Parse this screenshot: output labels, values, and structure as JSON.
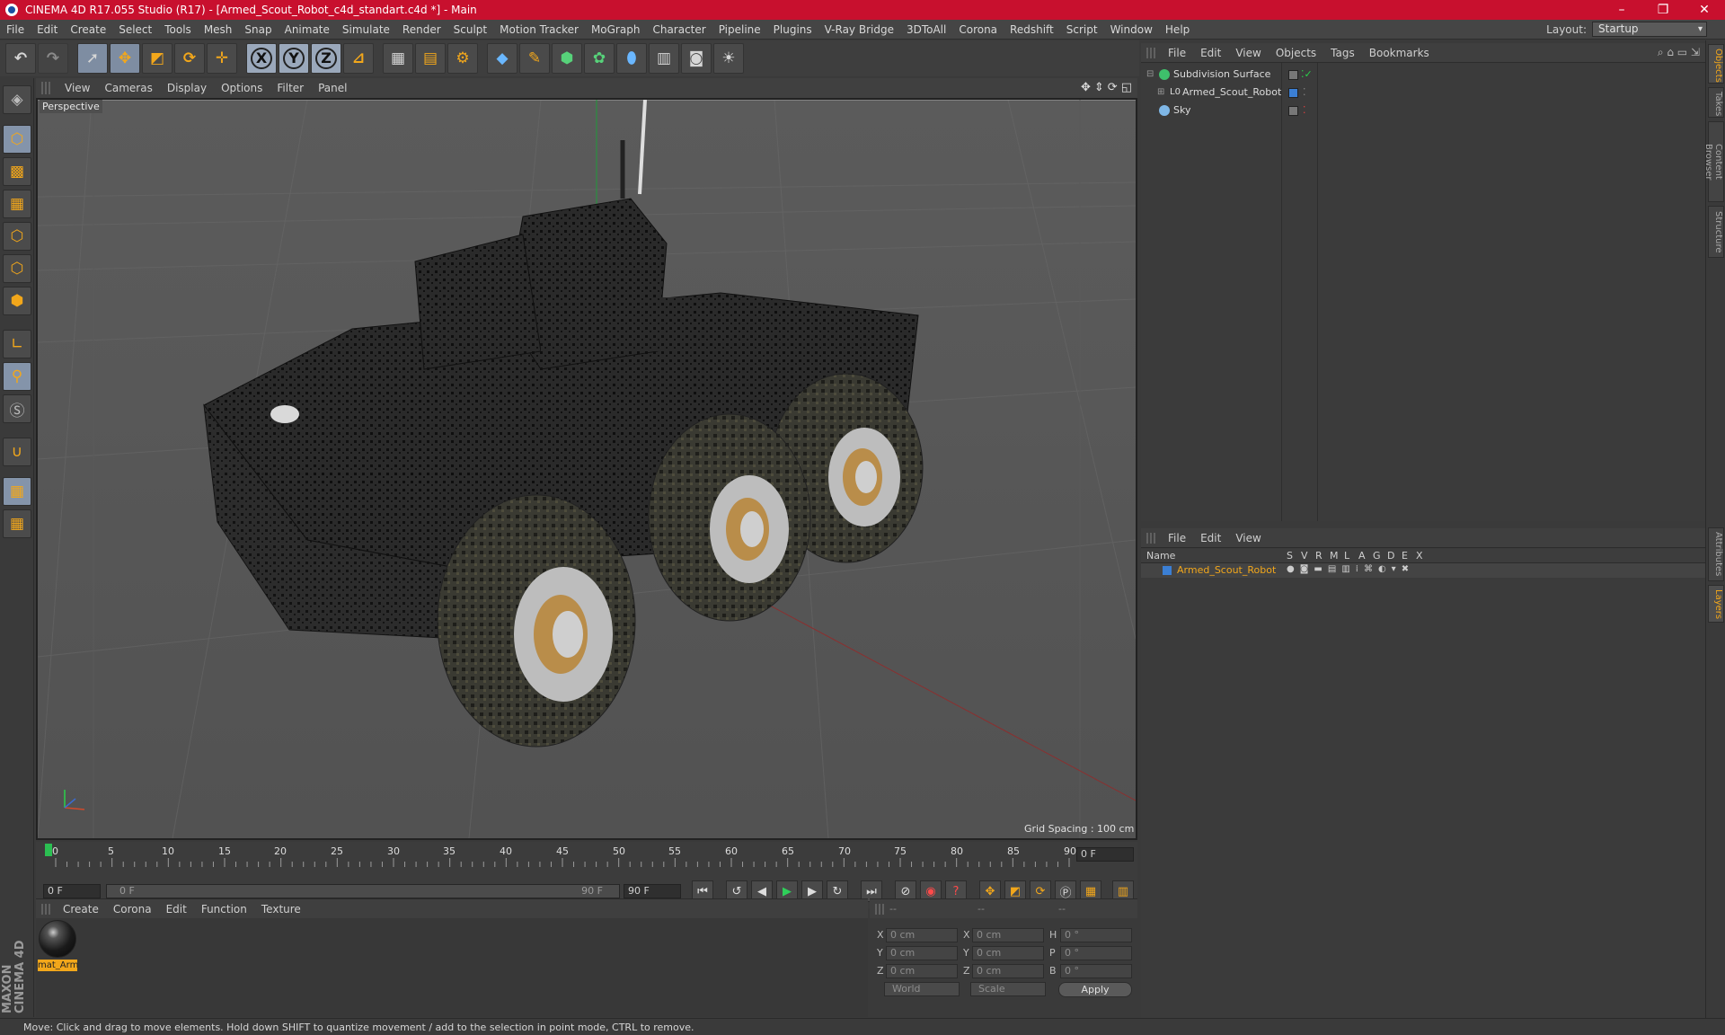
{
  "window": {
    "title": "CINEMA 4D R17.055 Studio (R17) - [Armed_Scout_Robot_c4d_standart.c4d *] - Main",
    "controls": [
      "–",
      "❐",
      "✕"
    ]
  },
  "menubar": {
    "items": [
      "File",
      "Edit",
      "Create",
      "Select",
      "Tools",
      "Mesh",
      "Snap",
      "Animate",
      "Simulate",
      "Render",
      "Sculpt",
      "Motion Tracker",
      "MoGraph",
      "Character",
      "Pipeline",
      "Plugins",
      "V-Ray Bridge",
      "3DToAll",
      "Corona",
      "Redshift",
      "Script",
      "Window",
      "Help"
    ],
    "layout_label": "Layout:",
    "layout_value": "Startup"
  },
  "toolbar": {
    "icons": [
      "undo-icon",
      "redo-icon",
      "select-icon",
      "move-icon",
      "scale-icon",
      "rotate-icon",
      "live-select-icon",
      "x-axis-icon",
      "y-axis-icon",
      "z-axis-icon",
      "coordinate-system-icon",
      "render-view-icon",
      "render-picture-viewer-icon",
      "render-settings-icon",
      "cube-icon",
      "pen-icon",
      "subdivision-icon",
      "cloner-icon",
      "deformer-icon",
      "floor-icon",
      "camera-icon",
      "light-icon"
    ],
    "axis_labels": [
      "X",
      "Y",
      "Z"
    ]
  },
  "viewport": {
    "menu": [
      "View",
      "Cameras",
      "Display",
      "Options",
      "Filter",
      "Panel"
    ],
    "label": "Perspective",
    "grid_spacing": "Grid Spacing : 100 cm"
  },
  "timeline": {
    "ticks": [
      "0",
      "5",
      "10",
      "15",
      "20",
      "25",
      "30",
      "35",
      "40",
      "45",
      "50",
      "55",
      "60",
      "65",
      "70",
      "75",
      "80",
      "85",
      "90"
    ],
    "current_frame": "0 F",
    "start": "0 F",
    "slider_start": "0 F",
    "slider_end": "90 F",
    "end": "90 F"
  },
  "material_manager": {
    "menu": [
      "Create",
      "Corona",
      "Edit",
      "Function",
      "Texture"
    ],
    "materials": [
      {
        "name": "mat_Arm"
      }
    ]
  },
  "coordinates": {
    "header": [
      "--",
      "--",
      "--"
    ],
    "rows": [
      {
        "a": "X",
        "a_val": "0 cm",
        "b": "X",
        "b_val": "0 cm",
        "c": "H",
        "c_val": "0 °"
      },
      {
        "a": "Y",
        "a_val": "0 cm",
        "b": "Y",
        "b_val": "0 cm",
        "c": "P",
        "c_val": "0 °"
      },
      {
        "a": "Z",
        "a_val": "0 cm",
        "b": "Z",
        "b_val": "0 cm",
        "c": "B",
        "c_val": "0 °"
      }
    ],
    "mode1": "World",
    "mode2": "Scale",
    "apply": "Apply"
  },
  "object_manager": {
    "menu": [
      "File",
      "Edit",
      "View",
      "Objects",
      "Tags",
      "Bookmarks"
    ],
    "objects": [
      {
        "name": "Subdivision Surface"
      },
      {
        "name": "Armed_Scout_Robot"
      },
      {
        "name": "Sky"
      }
    ]
  },
  "layer_manager": {
    "menu": [
      "File",
      "Edit",
      "View"
    ],
    "columns": [
      "Name",
      "S",
      "V",
      "R",
      "M",
      "L",
      "A",
      "G",
      "D",
      "E",
      "X"
    ],
    "layers": [
      {
        "name": "Armed_Scout_Robot",
        "color": "#3b7fd4"
      }
    ]
  },
  "right_tabs": [
    "Objects",
    "Takes",
    "Content Browser",
    "Structure",
    "Attributes",
    "Layers"
  ],
  "statusbar": {
    "text": "Move: Click and drag to move elements. Hold down SHIFT to quantize movement / add to the selection in point mode, CTRL to remove."
  },
  "brand": {
    "text": "MAXON CINEMA 4D"
  },
  "colors": {
    "titlebar": "#c8102e",
    "accent": "#f2a71b",
    "selection": "#7e8da2"
  }
}
